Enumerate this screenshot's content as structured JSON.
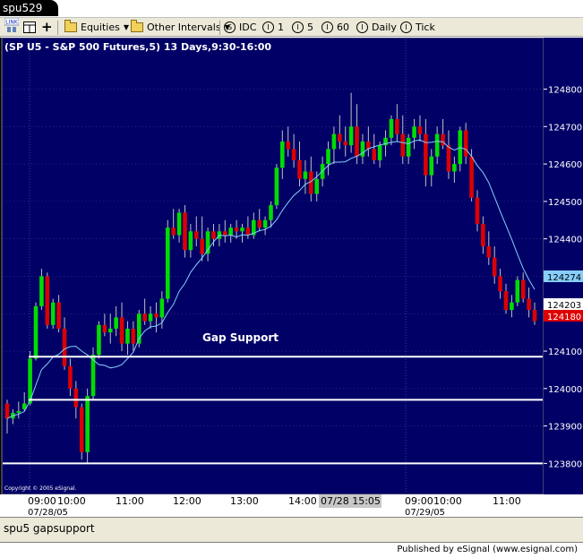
{
  "window": {
    "title": "spu529"
  },
  "toolbar": {
    "items": [
      {
        "name": "link-icon",
        "label": "LINK"
      },
      {
        "name": "layout-icon",
        "label": ""
      },
      {
        "name": "crosshair-icon",
        "label": "+"
      },
      {
        "name": "equities-menu",
        "label": "Equities"
      },
      {
        "name": "other-intervals-menu",
        "label": "Other Intervals"
      },
      {
        "name": "interval-idc",
        "label": "IDC",
        "glyph": "S"
      },
      {
        "name": "interval-1",
        "label": "1",
        "glyph": "I"
      },
      {
        "name": "interval-5",
        "label": "5",
        "glyph": "I"
      },
      {
        "name": "interval-60",
        "label": "60",
        "glyph": "I"
      },
      {
        "name": "interval-daily",
        "label": "Daily",
        "glyph": "I"
      },
      {
        "name": "interval-tick",
        "label": "Tick",
        "glyph": "I"
      }
    ]
  },
  "status": {
    "text": "spu5 gapsupport"
  },
  "footer": {
    "published": "Published by eSignal (www.esignal.com)"
  },
  "colors": {
    "background": "#000066",
    "up": "#00dd00",
    "down": "#dd0000",
    "ma": "#87cefa",
    "support_line": "#ffffff"
  },
  "chart_data": {
    "type": "candlestick",
    "title": "(SP U5 - S&P 500 Futures,5) 13 Days,9:30-16:00",
    "copyright": "Copyright © 2005 eSignal.",
    "annotation": "Gap Support",
    "y_ticks": [
      124800,
      124700,
      124600,
      124500,
      124400,
      124300,
      124200,
      124100,
      124000,
      123900,
      123800
    ],
    "ylim": [
      123765,
      124885
    ],
    "x_labels": [
      "09:00",
      "10:00",
      "11:00",
      "12:00",
      "13:00",
      "14:00",
      "07/28 15:05",
      "09:00",
      "10:00",
      "11:00"
    ],
    "date_labels": [
      "07/28/05",
      "07/29/05"
    ],
    "price_tags": [
      {
        "label": "124274",
        "value": 124274,
        "color": "#87cefa"
      },
      {
        "label": "124203",
        "value": 124203,
        "color": "#ffffff"
      },
      {
        "label": "124180",
        "value": 124180,
        "color": "#dd0000"
      }
    ],
    "support_lines": [
      124085,
      123970,
      123800
    ],
    "candles": [
      [
        123960,
        123970,
        123880,
        123920
      ],
      [
        123920,
        123945,
        123905,
        123935
      ],
      [
        123935,
        123965,
        123920,
        123940
      ],
      [
        123945,
        123990,
        123940,
        123960
      ],
      [
        123960,
        124100,
        123955,
        124080
      ],
      [
        124080,
        124230,
        124075,
        124220
      ],
      [
        124220,
        124320,
        124210,
        124300
      ],
      [
        124300,
        124310,
        124160,
        124170
      ],
      [
        124170,
        124240,
        124160,
        124230
      ],
      [
        124230,
        124250,
        124150,
        124160
      ],
      [
        124160,
        124190,
        124050,
        124060
      ],
      [
        124060,
        124080,
        123980,
        124000
      ],
      [
        124000,
        124020,
        123920,
        123950
      ],
      [
        123950,
        123960,
        123810,
        123830
      ],
      [
        123830,
        124000,
        123800,
        123980
      ],
      [
        123980,
        124110,
        123970,
        124090
      ],
      [
        124090,
        124180,
        124080,
        124170
      ],
      [
        124170,
        124200,
        124140,
        124150
      ],
      [
        124150,
        124200,
        124120,
        124160
      ],
      [
        124160,
        124220,
        124140,
        124190
      ],
      [
        124190,
        124230,
        124100,
        124120
      ],
      [
        124120,
        124180,
        124090,
        124160
      ],
      [
        124160,
        124180,
        124100,
        124120
      ],
      [
        124120,
        124210,
        124110,
        124200
      ],
      [
        124200,
        124240,
        124170,
        124180
      ],
      [
        124180,
        124220,
        124160,
        124200
      ],
      [
        124200,
        124230,
        124150,
        124190
      ],
      [
        124190,
        124260,
        124160,
        124240
      ],
      [
        124240,
        124450,
        124230,
        124430
      ],
      [
        124430,
        124480,
        124400,
        124410
      ],
      [
        124410,
        124480,
        124390,
        124470
      ],
      [
        124470,
        124490,
        124350,
        124370
      ],
      [
        124370,
        124440,
        124350,
        124420
      ],
      [
        124420,
        124460,
        124380,
        124400
      ],
      [
        124400,
        124460,
        124340,
        124360
      ],
      [
        124360,
        124430,
        124340,
        124420
      ],
      [
        124420,
        124440,
        124380,
        124400
      ],
      [
        124400,
        124440,
        124380,
        124420
      ],
      [
        124420,
        124450,
        124390,
        124410
      ],
      [
        124410,
        124440,
        124390,
        124430
      ],
      [
        124430,
        124450,
        124400,
        124420
      ],
      [
        124420,
        124440,
        124390,
        124430
      ],
      [
        124430,
        124460,
        124400,
        124410
      ],
      [
        124410,
        124470,
        124400,
        124450
      ],
      [
        124450,
        124480,
        124420,
        124430
      ],
      [
        124430,
        124460,
        124410,
        124450
      ],
      [
        124450,
        124500,
        124430,
        124490
      ],
      [
        124490,
        124600,
        124480,
        124590
      ],
      [
        124590,
        124690,
        124560,
        124660
      ],
      [
        124660,
        124700,
        124620,
        124640
      ],
      [
        124640,
        124680,
        124590,
        124610
      ],
      [
        124610,
        124660,
        124540,
        124560
      ],
      [
        124560,
        124610,
        124520,
        124580
      ],
      [
        124580,
        124620,
        124500,
        124520
      ],
      [
        124520,
        124580,
        124500,
        124560
      ],
      [
        124560,
        124620,
        124540,
        124600
      ],
      [
        124600,
        124660,
        124570,
        124640
      ],
      [
        124640,
        124700,
        124600,
        124680
      ],
      [
        124680,
        124730,
        124640,
        124660
      ],
      [
        124660,
        124700,
        124620,
        124650
      ],
      [
        124650,
        124790,
        124630,
        124700
      ],
      [
        124700,
        124760,
        124600,
        124620
      ],
      [
        124620,
        124680,
        124600,
        124660
      ],
      [
        124660,
        124700,
        124620,
        124640
      ],
      [
        124640,
        124680,
        124600,
        124610
      ],
      [
        124610,
        124660,
        124590,
        124650
      ],
      [
        124650,
        124690,
        124620,
        124670
      ],
      [
        124670,
        124730,
        124650,
        124720
      ],
      [
        124720,
        124760,
        124660,
        124680
      ],
      [
        124680,
        124730,
        124600,
        124620
      ],
      [
        124620,
        124680,
        124600,
        124670
      ],
      [
        124670,
        124720,
        124640,
        124700
      ],
      [
        124700,
        124730,
        124660,
        124680
      ],
      [
        124680,
        124720,
        124540,
        124570
      ],
      [
        124570,
        124640,
        124540,
        124620
      ],
      [
        124620,
        124700,
        124600,
        124680
      ],
      [
        124680,
        124720,
        124640,
        124650
      ],
      [
        124650,
        124690,
        124560,
        124580
      ],
      [
        124580,
        124620,
        124550,
        124600
      ],
      [
        124600,
        124700,
        124580,
        124690
      ],
      [
        124690,
        124710,
        124600,
        124620
      ],
      [
        124620,
        124640,
        124500,
        124510
      ],
      [
        124510,
        124530,
        124420,
        124440
      ],
      [
        124440,
        124460,
        124360,
        124380
      ],
      [
        124380,
        124420,
        124330,
        124350
      ],
      [
        124350,
        124380,
        124280,
        124300
      ],
      [
        124300,
        124320,
        124240,
        124260
      ],
      [
        124260,
        124280,
        124200,
        124210
      ],
      [
        124210,
        124250,
        124190,
        124230
      ],
      [
        124230,
        124300,
        124220,
        124290
      ],
      [
        124290,
        124310,
        124230,
        124240
      ],
      [
        124240,
        124270,
        124190,
        124210
      ],
      [
        124210,
        124230,
        124170,
        124180
      ]
    ]
  }
}
